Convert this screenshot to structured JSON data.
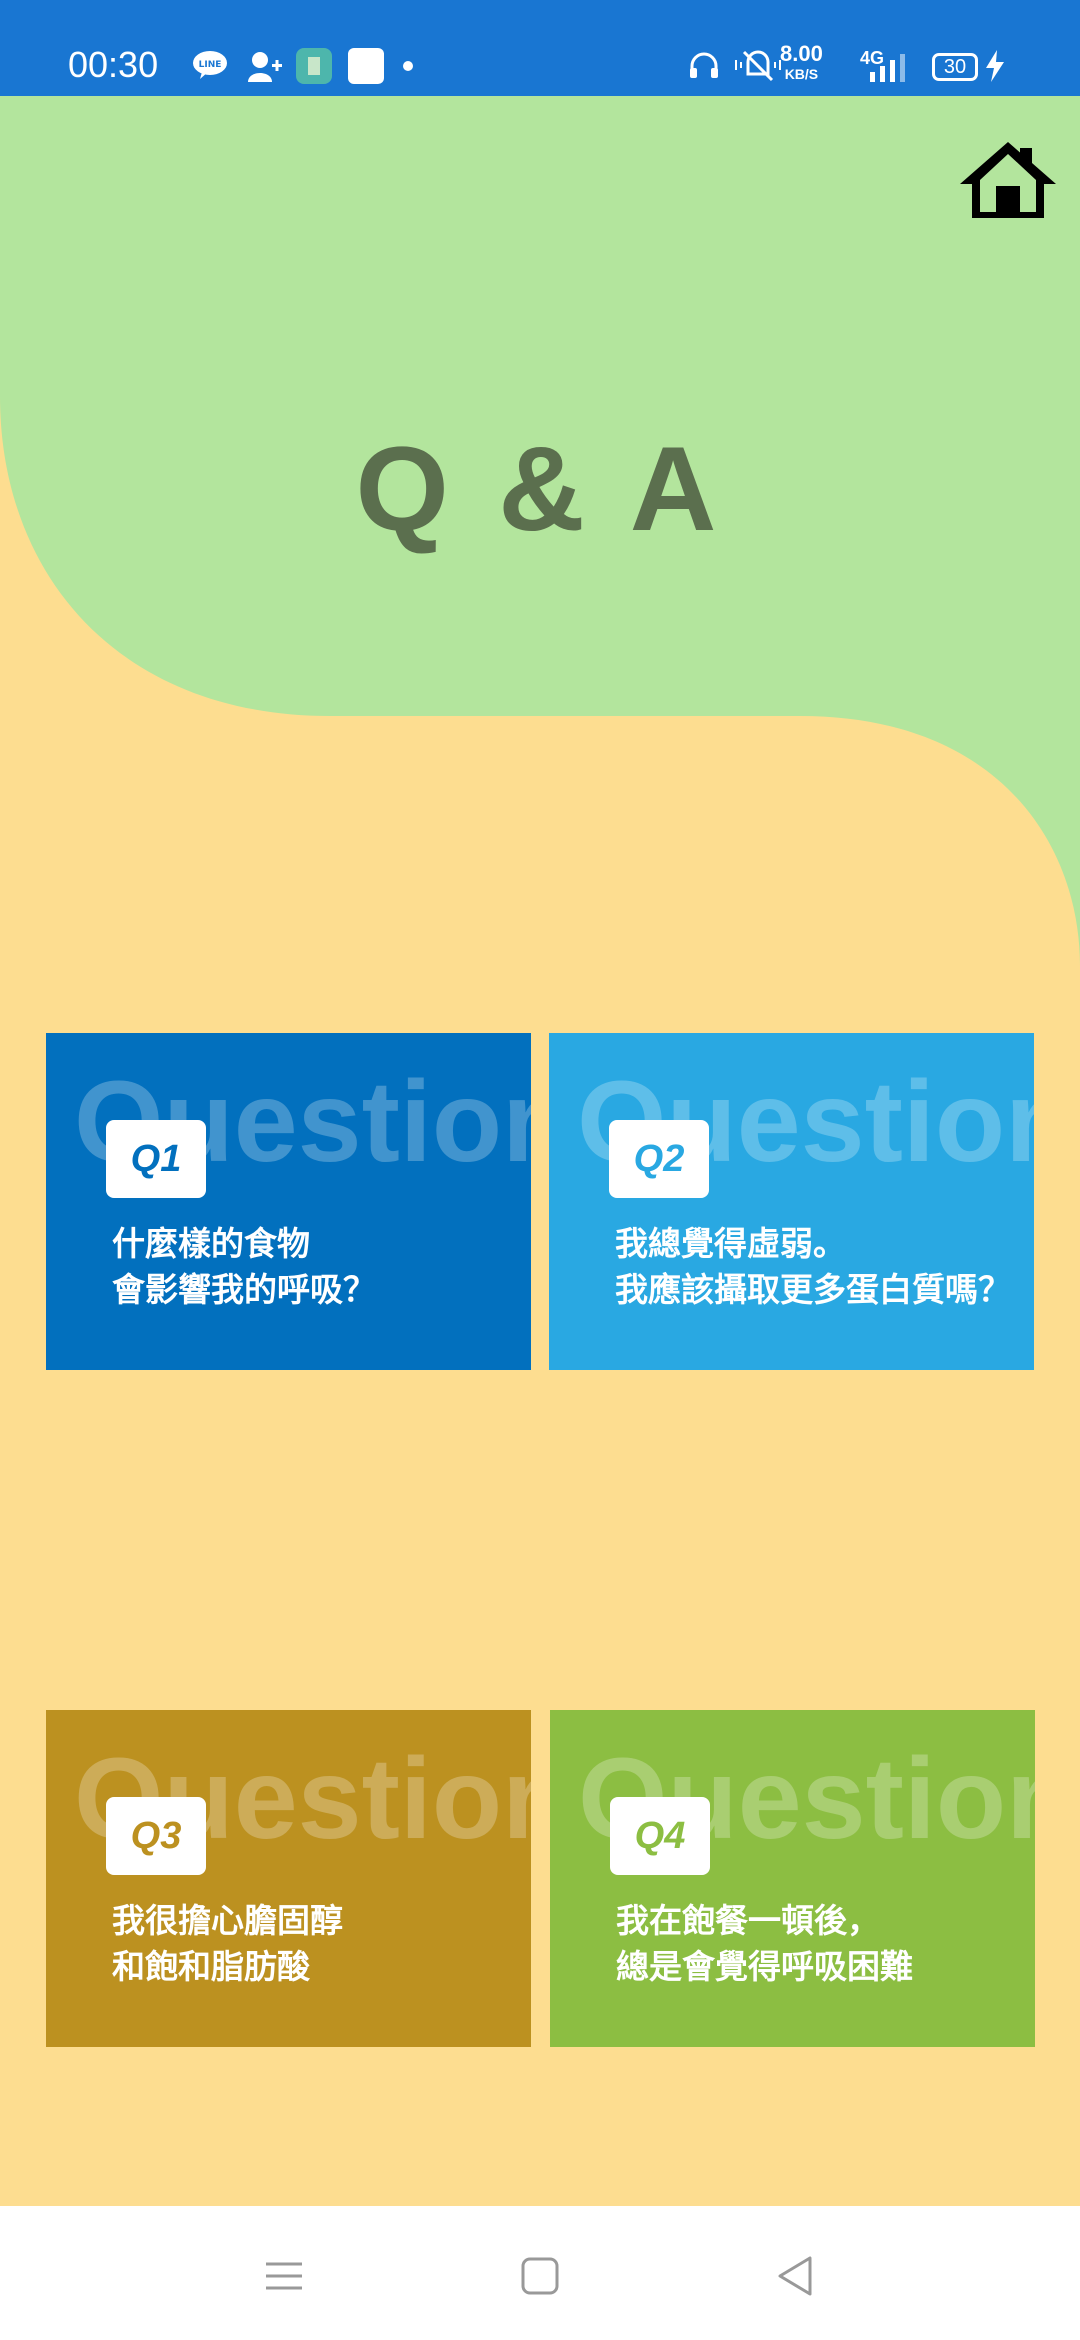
{
  "status_bar": {
    "time": "00:30",
    "net_speed": "8.00",
    "net_unit": "KB/S",
    "network": "4G",
    "battery": "30",
    "icons": [
      "line-icon",
      "add-contact-icon",
      "app-icon",
      "white-square-icon",
      "dot-icon",
      "headset-icon",
      "vibrate-icon",
      "signal-icon",
      "battery-icon",
      "charging-icon"
    ]
  },
  "page": {
    "title": "Q & A",
    "home_icon": "home-icon",
    "watermark": "Question",
    "colors": {
      "green": "#B3E59D",
      "beige": "#FDDD90",
      "title": "#5B6F4E"
    }
  },
  "cards": [
    {
      "badge": "Q1",
      "question": "什麼樣的食物\n會影響我的呼吸？",
      "color": "#0270BE"
    },
    {
      "badge": "Q2",
      "question": "我總覺得虛弱。\n我應該攝取更多蛋白質嗎？",
      "color": "#29A8E2"
    },
    {
      "badge": "Q3",
      "question": "我很擔心膽固醇\n和飽和脂肪酸",
      "color": "#BC9120"
    },
    {
      "badge": "Q4",
      "question": "我在飽餐一頓後，\n總是會覺得呼吸困難",
      "color": "#8CBE42"
    }
  ],
  "nav": {
    "icons": [
      "menu-icon",
      "home-square-icon",
      "back-icon"
    ]
  }
}
